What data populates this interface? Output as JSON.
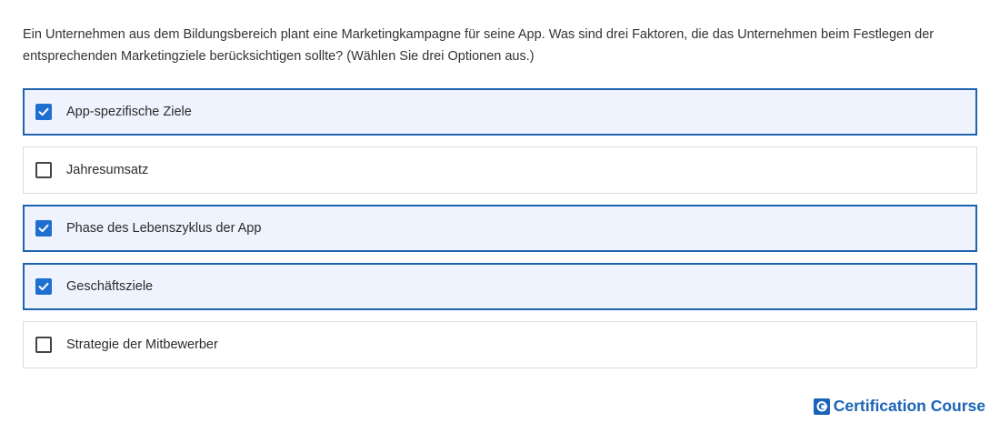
{
  "question": {
    "line1": "Ein Unternehmen aus dem Bildungsbereich plant eine Marketingkampagne für seine App. Was sind drei Faktoren, die das Unternehmen beim Festlegen der",
    "line2": "entsprechenden Marketingziele berücksichtigen sollte? (Wählen Sie drei Optionen aus.)"
  },
  "options": [
    {
      "label": "App-spezifische Ziele",
      "checked": true
    },
    {
      "label": "Jahresumsatz",
      "checked": false
    },
    {
      "label": "Phase des Lebenszyklus der App",
      "checked": true
    },
    {
      "label": "Geschäftsziele",
      "checked": true
    },
    {
      "label": "Strategie der Mitbewerber",
      "checked": false
    }
  ],
  "brand": {
    "icon": "g-logo-icon",
    "text": "Certification Course",
    "color": "#1a63b8"
  },
  "colors": {
    "checked_border": "#1f63b0",
    "checked_background": "#eef3fd",
    "checkbox_fill": "#1f6fd1"
  }
}
